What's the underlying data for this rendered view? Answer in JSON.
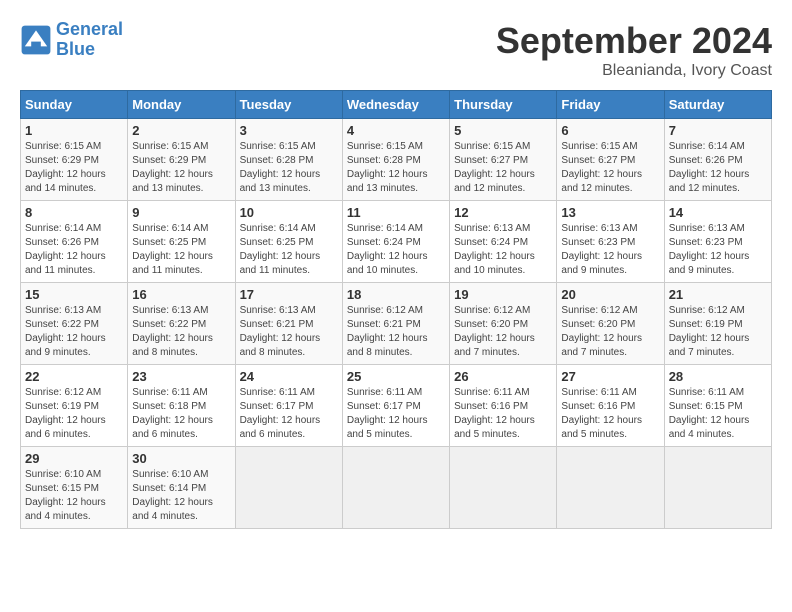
{
  "logo": {
    "line1": "General",
    "line2": "Blue"
  },
  "title": "September 2024",
  "subtitle": "Bleanianda, Ivory Coast",
  "days_header": [
    "Sunday",
    "Monday",
    "Tuesday",
    "Wednesday",
    "Thursday",
    "Friday",
    "Saturday"
  ],
  "weeks": [
    [
      {
        "day": "1",
        "info": "Sunrise: 6:15 AM\nSunset: 6:29 PM\nDaylight: 12 hours\nand 14 minutes."
      },
      {
        "day": "2",
        "info": "Sunrise: 6:15 AM\nSunset: 6:29 PM\nDaylight: 12 hours\nand 13 minutes."
      },
      {
        "day": "3",
        "info": "Sunrise: 6:15 AM\nSunset: 6:28 PM\nDaylight: 12 hours\nand 13 minutes."
      },
      {
        "day": "4",
        "info": "Sunrise: 6:15 AM\nSunset: 6:28 PM\nDaylight: 12 hours\nand 13 minutes."
      },
      {
        "day": "5",
        "info": "Sunrise: 6:15 AM\nSunset: 6:27 PM\nDaylight: 12 hours\nand 12 minutes."
      },
      {
        "day": "6",
        "info": "Sunrise: 6:15 AM\nSunset: 6:27 PM\nDaylight: 12 hours\nand 12 minutes."
      },
      {
        "day": "7",
        "info": "Sunrise: 6:14 AM\nSunset: 6:26 PM\nDaylight: 12 hours\nand 12 minutes."
      }
    ],
    [
      {
        "day": "8",
        "info": "Sunrise: 6:14 AM\nSunset: 6:26 PM\nDaylight: 12 hours\nand 11 minutes."
      },
      {
        "day": "9",
        "info": "Sunrise: 6:14 AM\nSunset: 6:25 PM\nDaylight: 12 hours\nand 11 minutes."
      },
      {
        "day": "10",
        "info": "Sunrise: 6:14 AM\nSunset: 6:25 PM\nDaylight: 12 hours\nand 11 minutes."
      },
      {
        "day": "11",
        "info": "Sunrise: 6:14 AM\nSunset: 6:24 PM\nDaylight: 12 hours\nand 10 minutes."
      },
      {
        "day": "12",
        "info": "Sunrise: 6:13 AM\nSunset: 6:24 PM\nDaylight: 12 hours\nand 10 minutes."
      },
      {
        "day": "13",
        "info": "Sunrise: 6:13 AM\nSunset: 6:23 PM\nDaylight: 12 hours\nand 9 minutes."
      },
      {
        "day": "14",
        "info": "Sunrise: 6:13 AM\nSunset: 6:23 PM\nDaylight: 12 hours\nand 9 minutes."
      }
    ],
    [
      {
        "day": "15",
        "info": "Sunrise: 6:13 AM\nSunset: 6:22 PM\nDaylight: 12 hours\nand 9 minutes."
      },
      {
        "day": "16",
        "info": "Sunrise: 6:13 AM\nSunset: 6:22 PM\nDaylight: 12 hours\nand 8 minutes."
      },
      {
        "day": "17",
        "info": "Sunrise: 6:13 AM\nSunset: 6:21 PM\nDaylight: 12 hours\nand 8 minutes."
      },
      {
        "day": "18",
        "info": "Sunrise: 6:12 AM\nSunset: 6:21 PM\nDaylight: 12 hours\nand 8 minutes."
      },
      {
        "day": "19",
        "info": "Sunrise: 6:12 AM\nSunset: 6:20 PM\nDaylight: 12 hours\nand 7 minutes."
      },
      {
        "day": "20",
        "info": "Sunrise: 6:12 AM\nSunset: 6:20 PM\nDaylight: 12 hours\nand 7 minutes."
      },
      {
        "day": "21",
        "info": "Sunrise: 6:12 AM\nSunset: 6:19 PM\nDaylight: 12 hours\nand 7 minutes."
      }
    ],
    [
      {
        "day": "22",
        "info": "Sunrise: 6:12 AM\nSunset: 6:19 PM\nDaylight: 12 hours\nand 6 minutes."
      },
      {
        "day": "23",
        "info": "Sunrise: 6:11 AM\nSunset: 6:18 PM\nDaylight: 12 hours\nand 6 minutes."
      },
      {
        "day": "24",
        "info": "Sunrise: 6:11 AM\nSunset: 6:17 PM\nDaylight: 12 hours\nand 6 minutes."
      },
      {
        "day": "25",
        "info": "Sunrise: 6:11 AM\nSunset: 6:17 PM\nDaylight: 12 hours\nand 5 minutes."
      },
      {
        "day": "26",
        "info": "Sunrise: 6:11 AM\nSunset: 6:16 PM\nDaylight: 12 hours\nand 5 minutes."
      },
      {
        "day": "27",
        "info": "Sunrise: 6:11 AM\nSunset: 6:16 PM\nDaylight: 12 hours\nand 5 minutes."
      },
      {
        "day": "28",
        "info": "Sunrise: 6:11 AM\nSunset: 6:15 PM\nDaylight: 12 hours\nand 4 minutes."
      }
    ],
    [
      {
        "day": "29",
        "info": "Sunrise: 6:10 AM\nSunset: 6:15 PM\nDaylight: 12 hours\nand 4 minutes."
      },
      {
        "day": "30",
        "info": "Sunrise: 6:10 AM\nSunset: 6:14 PM\nDaylight: 12 hours\nand 4 minutes."
      },
      {
        "day": "",
        "info": ""
      },
      {
        "day": "",
        "info": ""
      },
      {
        "day": "",
        "info": ""
      },
      {
        "day": "",
        "info": ""
      },
      {
        "day": "",
        "info": ""
      }
    ]
  ]
}
